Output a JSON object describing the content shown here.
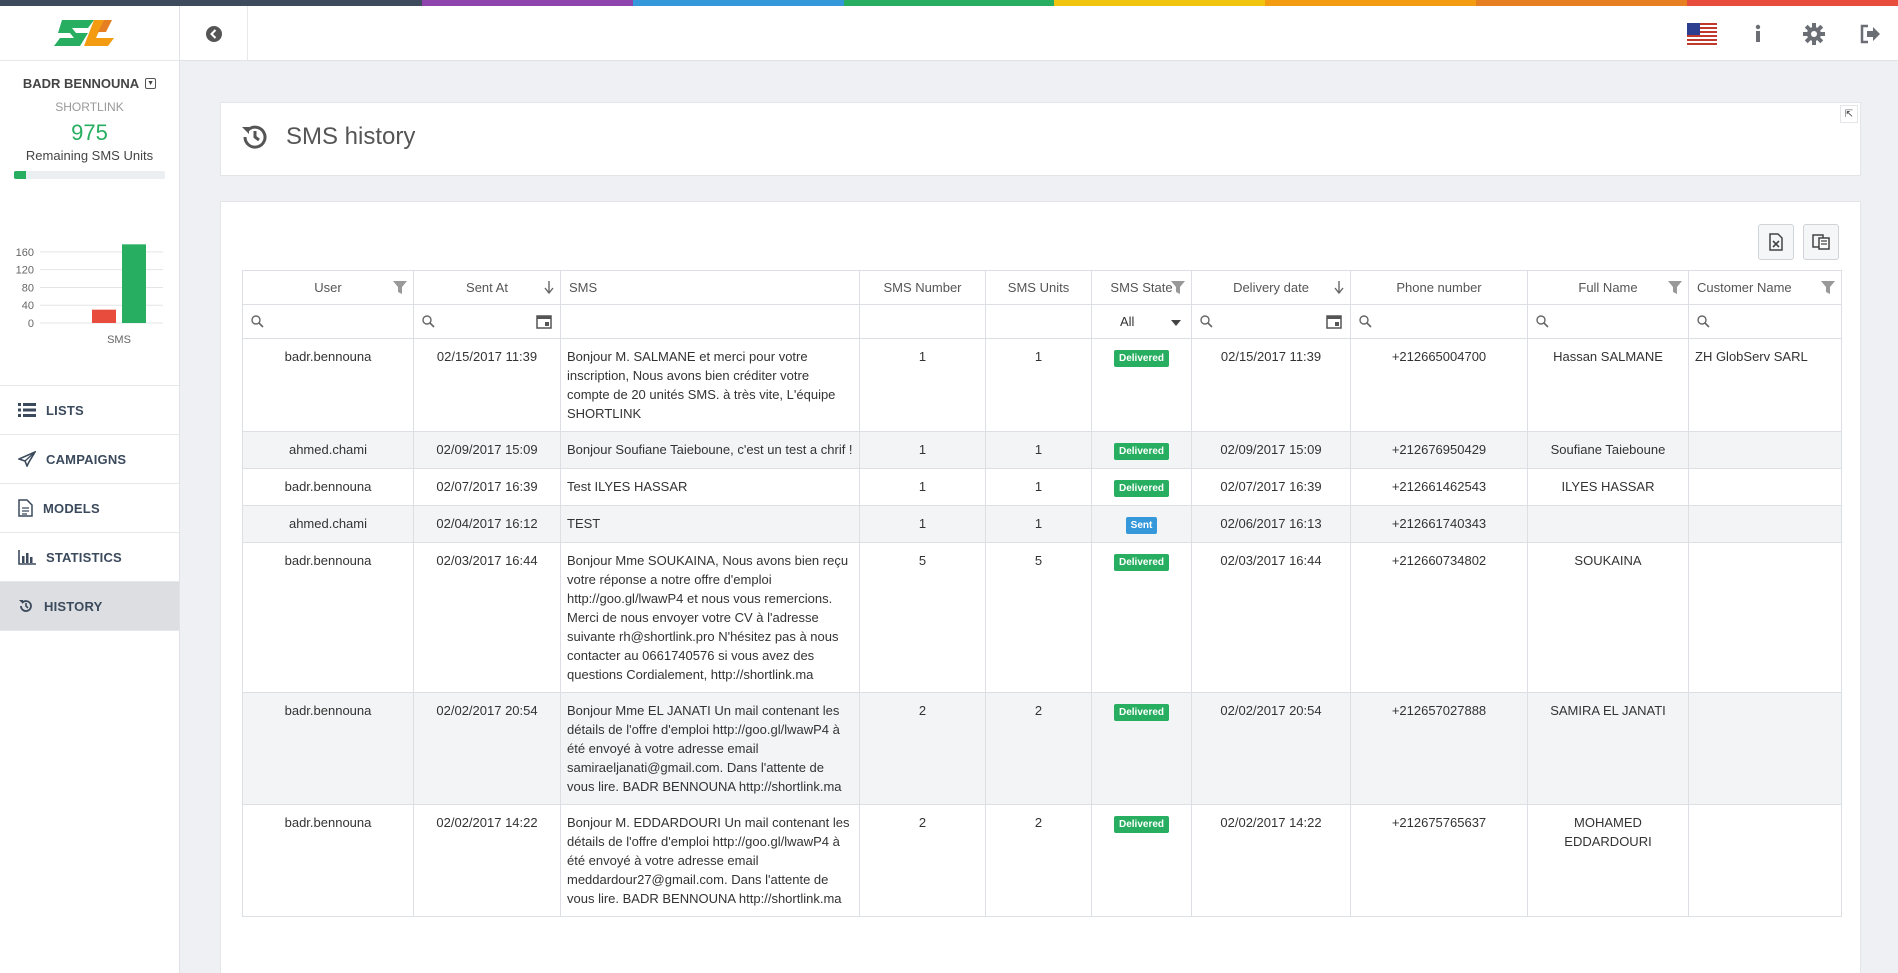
{
  "brand": {
    "logo_alt": "SL",
    "rainbow_colors": [
      "#3d4b5c",
      "#3d4b5c",
      "#8e44ad",
      "#3498db",
      "#27ae60",
      "#f1c40f",
      "#f39c12",
      "#e67e22",
      "#e74c3c"
    ]
  },
  "profile": {
    "name": "BADR BENNOUNA",
    "company": "SHORTLINK",
    "units": "975",
    "units_label": "Remaining SMS Units",
    "progress_fraction": 0.08
  },
  "mini_chart": {
    "type": "bar",
    "categories": [
      "SMS"
    ],
    "series": [
      {
        "values": [
          30
        ],
        "color": "#e74c3c"
      },
      {
        "values": [
          177
        ],
        "color": "#27ae60"
      }
    ],
    "y_ticks": [
      "160",
      "120",
      "80",
      "40",
      "0"
    ],
    "ylim": [
      0,
      180
    ],
    "xlabel": "SMS"
  },
  "nav": [
    {
      "label": "LISTS",
      "icon": "list-icon",
      "active": false
    },
    {
      "label": "CAMPAIGNS",
      "icon": "paper-plane-icon",
      "active": false
    },
    {
      "label": "MODELS",
      "icon": "document-icon",
      "active": false
    },
    {
      "label": "STATISTICS",
      "icon": "bar-chart-icon",
      "active": false
    },
    {
      "label": "HISTORY",
      "icon": "history-icon",
      "active": true
    }
  ],
  "page": {
    "title": "SMS history"
  },
  "table": {
    "columns": [
      "User",
      "Sent At",
      "SMS",
      "SMS Number",
      "SMS Units",
      "SMS State",
      "Delivery date",
      "Phone number",
      "Full Name",
      "Customer Name"
    ],
    "state_filter": "All",
    "rows": [
      {
        "user": "badr.bennouna",
        "sent_at": "02/15/2017 11:39",
        "sms": "Bonjour M. SALMANE et merci pour votre inscription, Nous avons bien créditer votre compte de 20 unités SMS. à très vite, L'équipe SHORTLINK",
        "number": "1",
        "units": "1",
        "state": "Delivered",
        "delivery": "02/15/2017 11:39",
        "phone": "+212665004700",
        "full_name": "Hassan SALMANE",
        "customer": "ZH GlobServ SARL"
      },
      {
        "user": "ahmed.chami",
        "sent_at": "02/09/2017 15:09",
        "sms": "Bonjour Soufiane Taieboune, c'est un test a chrif !",
        "number": "1",
        "units": "1",
        "state": "Delivered",
        "delivery": "02/09/2017 15:09",
        "phone": "+212676950429",
        "full_name": "Soufiane Taieboune",
        "customer": ""
      },
      {
        "user": "badr.bennouna",
        "sent_at": "02/07/2017 16:39",
        "sms": "Test ILYES HASSAR",
        "number": "1",
        "units": "1",
        "state": "Delivered",
        "delivery": "02/07/2017 16:39",
        "phone": "+212661462543",
        "full_name": "ILYES HASSAR",
        "customer": ""
      },
      {
        "user": "ahmed.chami",
        "sent_at": "02/04/2017 16:12",
        "sms": "TEST",
        "number": "1",
        "units": "1",
        "state": "Sent",
        "delivery": "02/06/2017 16:13",
        "phone": "+212661740343",
        "full_name": "",
        "customer": ""
      },
      {
        "user": "badr.bennouna",
        "sent_at": "02/03/2017 16:44",
        "sms": "Bonjour Mme SOUKAINA, Nous avons bien reçu votre réponse a notre offre d'emploi http://goo.gl/lwawP4 et nous vous remercions. Merci de nous envoyer votre CV à l'adresse suivante rh@shortlink.pro N'hésitez pas à nous contacter au 0661740576 si vous avez des questions Cordialement, http://shortlink.ma",
        "number": "5",
        "units": "5",
        "state": "Delivered",
        "delivery": "02/03/2017 16:44",
        "phone": "+212660734802",
        "full_name": "SOUKAINA",
        "customer": ""
      },
      {
        "user": "badr.bennouna",
        "sent_at": "02/02/2017 20:54",
        "sms": "Bonjour Mme EL JANATI Un mail contenant les détails de l'offre d'emploi http://goo.gl/lwawP4 à été envoyé à votre adresse email samiraeljanati@gmail.com. Dans l'attente de vous lire. BADR BENNOUNA http://shortlink.ma",
        "number": "2",
        "units": "2",
        "state": "Delivered",
        "delivery": "02/02/2017 20:54",
        "phone": "+212657027888",
        "full_name": "SAMIRA EL JANATI",
        "customer": ""
      },
      {
        "user": "badr.bennouna",
        "sent_at": "02/02/2017 14:22",
        "sms": "Bonjour M. EDDARDOURI Un mail contenant les détails de l'offre d'emploi http://goo.gl/lwawP4 à été envoyé à votre adresse email meddardour27@gmail.com. Dans l'attente de vous lire. BADR BENNOUNA http://shortlink.ma",
        "number": "2",
        "units": "2",
        "state": "Delivered",
        "delivery": "02/02/2017 14:22",
        "phone": "+212675765637",
        "full_name": "MOHAMED EDDARDOURI",
        "customer": ""
      }
    ]
  },
  "colors": {
    "delivered": "#27ae60",
    "sent": "#3498db",
    "accent_green": "#27ae60"
  }
}
